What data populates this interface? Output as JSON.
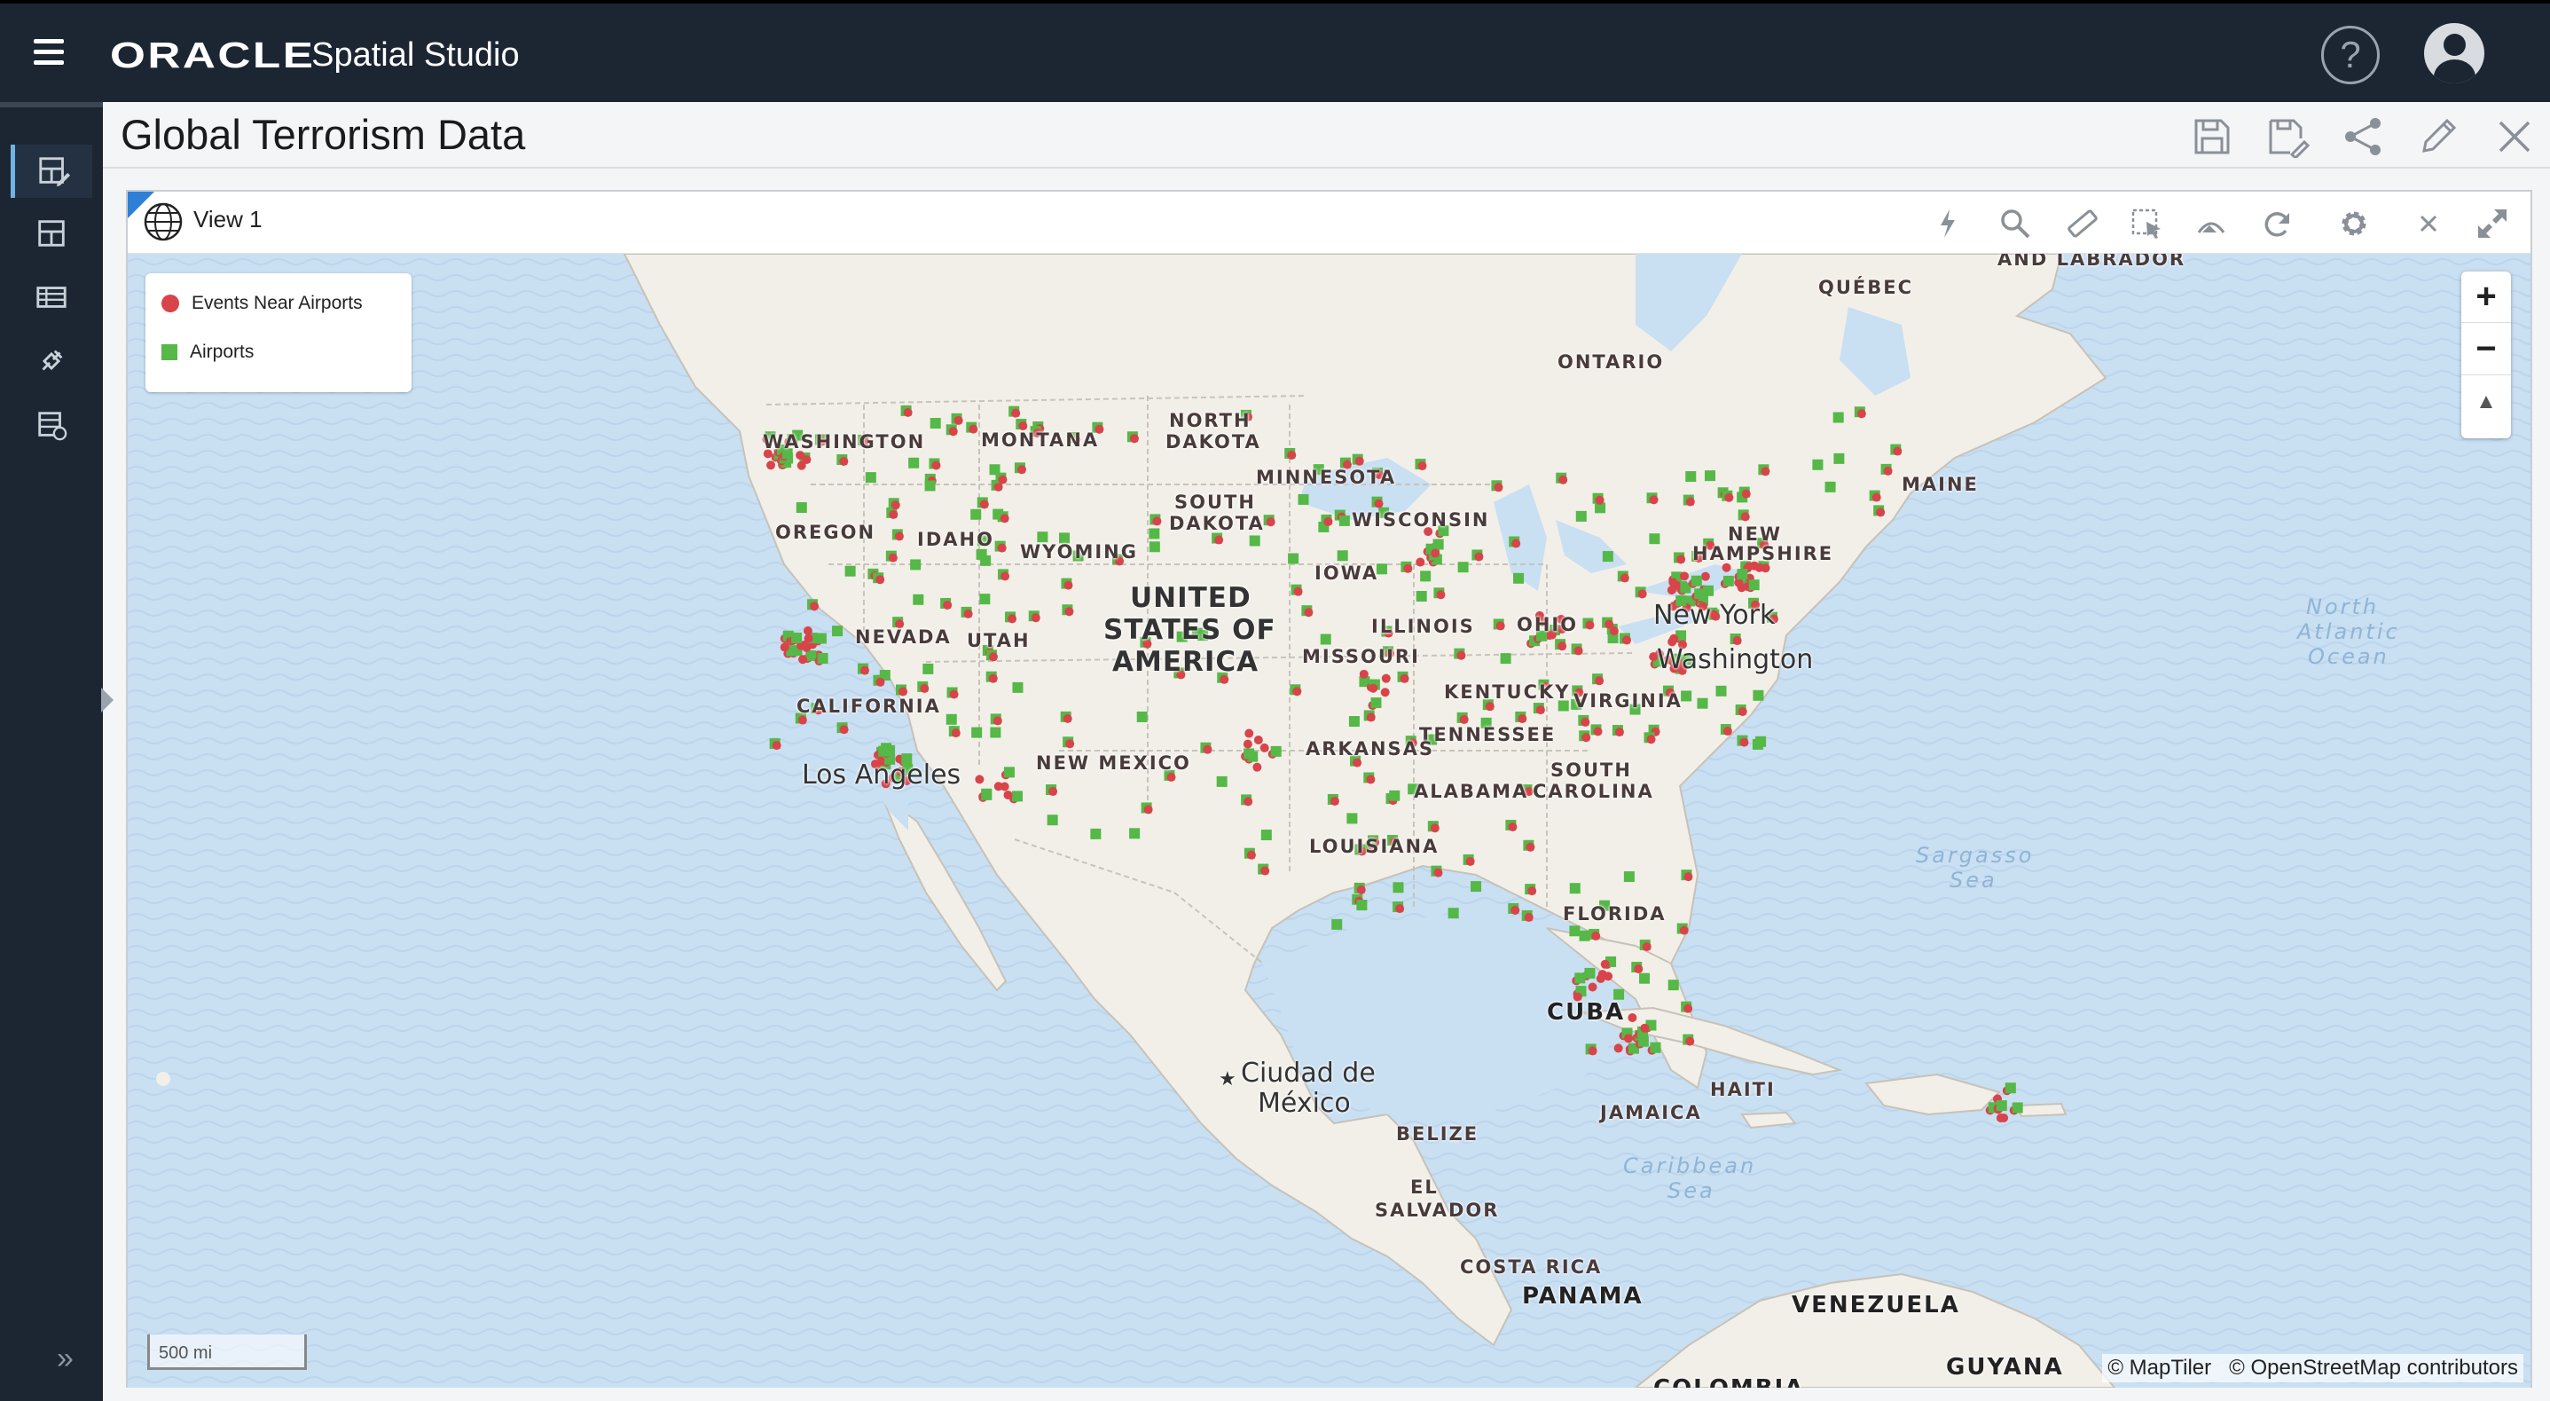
{
  "app": {
    "brand_oracle": "ORACLE",
    "brand_product": "Spatial Studio",
    "help_glyph": "?"
  },
  "project": {
    "title": "Global Terrorism Data"
  },
  "view": {
    "title": "View 1"
  },
  "legend": {
    "items": [
      {
        "label": "Events Near Airports",
        "color": "#d9434a",
        "shape": "circle"
      },
      {
        "label": "Airports",
        "color": "#55b847",
        "shape": "square"
      }
    ]
  },
  "map": {
    "zoom_in": "+",
    "zoom_out": "−",
    "north": "▲",
    "scale_label": "500 mi",
    "attribution_1": "© MapTiler",
    "attribution_2": "© OpenStreetMap contributors",
    "labels": {
      "labrador": "AND LABRADOR",
      "quebec": "QUÉBEC",
      "ontario": "ONTARIO",
      "washington": "WASHINGTON",
      "montana": "MONTANA",
      "north_dakota_1": "NORTH",
      "north_dakota_2": "DAKOTA",
      "minnesota": "MINNESOTA",
      "maine": "MAINE",
      "south_dakota_1": "SOUTH",
      "south_dakota_2": "DAKOTA",
      "wisconsin": "WISCONSIN",
      "oregon": "OREGON",
      "idaho": "IDAHO",
      "wyoming": "WYOMING",
      "new_hampshire_1": "NEW",
      "new_hampshire_2": "HAMPSHIRE",
      "iowa": "IOWA",
      "usa_1": "UNITED",
      "usa_2": "STATES OF",
      "usa_3": "AMERICA",
      "new_york": "New York",
      "nevada": "NEVADA",
      "utah": "UTAH",
      "illinois": "ILLINOIS",
      "ohio": "OHIO",
      "missouri": "MISSOURI",
      "washington_dc": "Washington",
      "kentucky": "KENTUCKY",
      "virginia": "VIRGINIA",
      "california": "CALIFORNIA",
      "tennessee": "TENNESSEE",
      "arkansas": "ARKANSAS",
      "new_mexico": "NEW MEXICO",
      "los_angeles": "Los Angeles",
      "south_carolina_1": "SOUTH",
      "south_carolina_2": "CAROLINA",
      "alabama": "ALABAMA",
      "louisiana": "LOUISIANA",
      "florida": "FLORIDA",
      "cuba": "CUBA",
      "mexico_city_1": "Ciudad de",
      "mexico_city_2": "México",
      "haiti": "HAITI",
      "jamaica": "JAMAICA",
      "belize": "BELIZE",
      "el_salvador_1": "EL",
      "el_salvador_2": "SALVADOR",
      "costa_rica": "COSTA RICA",
      "panama": "PANAMA",
      "venezuela": "VENEZUELA",
      "guyana": "GUYANA",
      "colombia": "COLOMBIA",
      "north_atlantic_1": "North",
      "north_atlantic_2": "Atlantic",
      "north_atlantic_3": "Ocean",
      "sargasso_1": "Sargasso",
      "sargasso_2": "Sea",
      "caribbean_1": "Caribbean",
      "caribbean_2": "Sea"
    }
  },
  "colors": {
    "topbar": "#1c2532",
    "event_red": "#d9434a",
    "airport_green": "#55b847",
    "water": "#c9dff2",
    "land": "#f2efe9"
  },
  "icons": {
    "sidebar": [
      "edit-layout-icon",
      "layout-icon",
      "table-icon",
      "connection-icon",
      "dataset-icon"
    ],
    "project_toolbar": [
      "save-icon",
      "save-as-icon",
      "share-icon",
      "edit-icon",
      "close-icon"
    ],
    "view_toolbar": [
      "flash-icon",
      "search-icon",
      "measure-icon",
      "select-icon",
      "signal-icon",
      "refresh-icon",
      "gear-icon",
      "close-icon",
      "maximize-icon"
    ]
  }
}
